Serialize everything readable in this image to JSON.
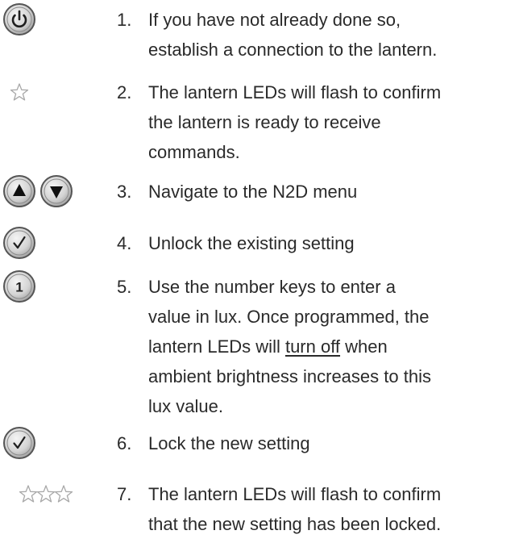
{
  "steps": [
    {
      "number": "1.",
      "lines": [
        "If you have not already done so,",
        "establish a connection to the lantern."
      ],
      "icons": [
        "power-button-icon"
      ]
    },
    {
      "number": "2.",
      "lines": [
        "The lantern LEDs will flash to confirm",
        "the lantern is ready to receive",
        "commands."
      ],
      "icons": [
        "star-outline-icon"
      ]
    },
    {
      "number": "3.",
      "lines": [
        "Navigate to the N2D menu"
      ],
      "icons": [
        "up-arrow-button-icon",
        "down-arrow-button-icon"
      ]
    },
    {
      "number": "4.",
      "lines": [
        "Unlock the existing setting"
      ],
      "icons": [
        "checkmark-button-icon"
      ]
    },
    {
      "number": "5.",
      "lines": [
        "Use the number keys to enter a",
        "value in lux. Once programmed, the",
        "lantern LEDs will ",
        "turn off",
        " when",
        "ambient brightness increases to this",
        "lux value."
      ],
      "icons": [
        "number-one-button-icon"
      ]
    },
    {
      "number": "6.",
      "lines": [
        "Lock the new setting"
      ],
      "icons": [
        "checkmark-button-icon"
      ]
    },
    {
      "number": "7.",
      "lines": [
        "The lantern LEDs will flash to confirm",
        "that the new setting has been locked."
      ],
      "icons": [
        "three-stars-outline-icon"
      ]
    }
  ],
  "colors": {
    "text": "#2a2a2a",
    "button_fill": "#d6d6d6",
    "button_ring": "#6e6e6e",
    "glyph": "#1f1f1f",
    "star_stroke": "#a8a8a8"
  }
}
